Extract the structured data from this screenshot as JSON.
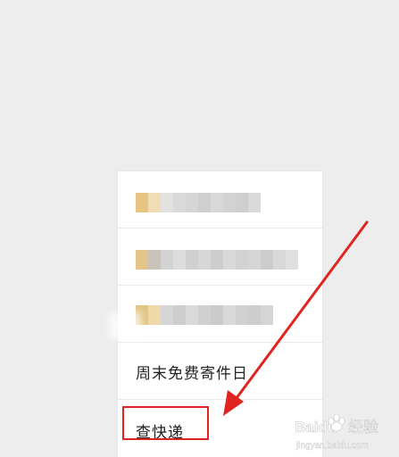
{
  "menu": {
    "items": [
      {
        "type": "blurred",
        "pixels": [
          "#e6c582",
          "#f0ddb3",
          "#e2e2e2",
          "#dadada",
          "#d6d6d6",
          "#cfcfcf",
          "#d8d8d8",
          "#d2d2d2",
          "#cfcfcf",
          "#dadada"
        ]
      },
      {
        "type": "blurred",
        "pixels": [
          "#e4c589",
          "#c9c3b9",
          "#d3d3d3",
          "#dddddd",
          "#d0d0d0",
          "#d7d7d7",
          "#cdcdcd",
          "#d9d9d9",
          "#d2d2d2",
          "#d6d6d6",
          "#cccccc",
          "#d8d8d8",
          "#e0e0e0"
        ]
      },
      {
        "type": "blurred",
        "pixels": [
          "#e3c685",
          "#efd9a8",
          "#d6d6d6",
          "#cecece",
          "#dadada",
          "#d0d0d0",
          "#cbcbcb",
          "#d9d9d9",
          "#d1d1d1",
          "#cdcdcd",
          "#d5d5d5"
        ]
      },
      {
        "type": "text",
        "label": "周末免费寄件日"
      },
      {
        "type": "text",
        "label": "查快递"
      }
    ]
  },
  "highlight": {
    "color": "#e0241f",
    "target": "查快递"
  },
  "arrow": {
    "color": "#e0241f"
  },
  "watermark": {
    "brand": "Baidu",
    "suffix": "经验",
    "domain": "jingyan.baidu.com"
  }
}
